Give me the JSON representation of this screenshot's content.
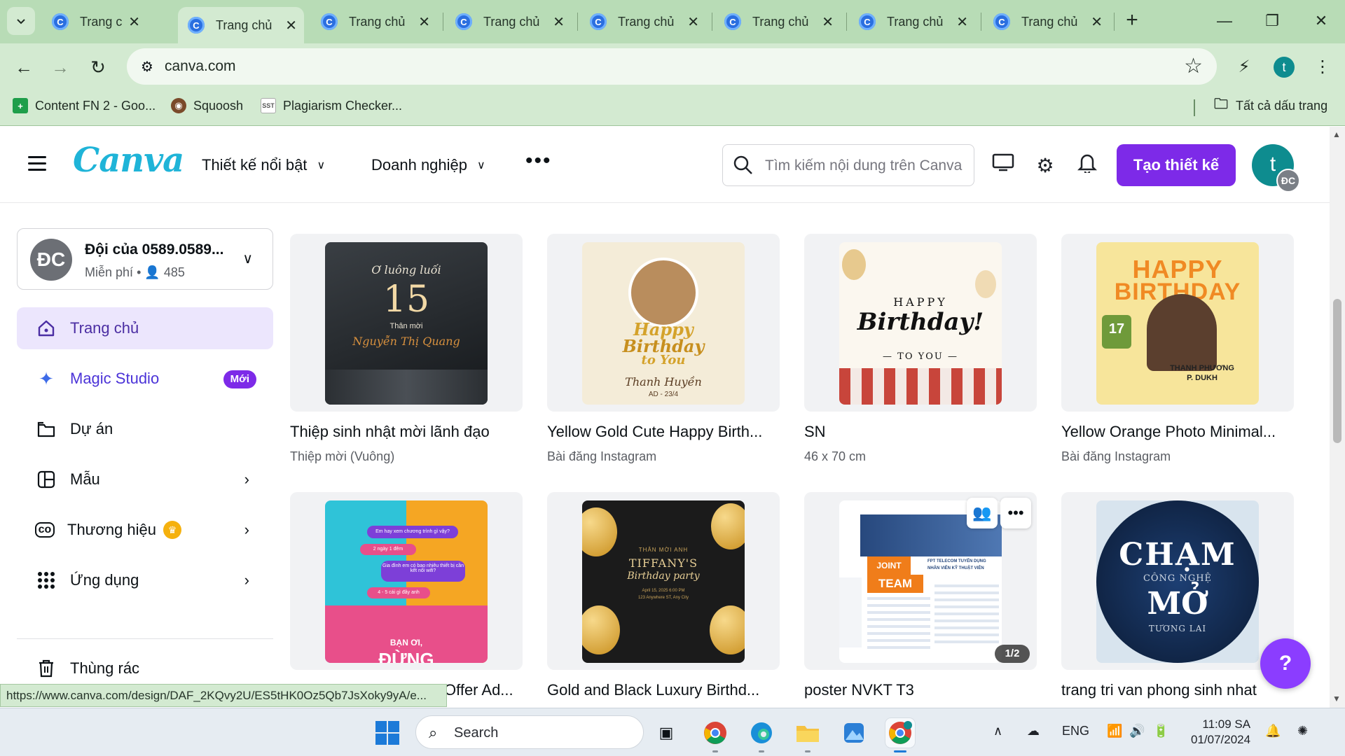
{
  "browser": {
    "tabs": [
      {
        "label": "Trang chủ",
        "active": false
      },
      {
        "label": "Trang chủ",
        "active": true
      },
      {
        "label": "Trang chủ",
        "active": false
      },
      {
        "label": "Trang chủ",
        "active": false
      },
      {
        "label": "Trang chủ",
        "active": false
      },
      {
        "label": "Trang chủ",
        "active": false
      },
      {
        "label": "Trang chủ",
        "active": false
      },
      {
        "label": "Trang chủ",
        "active": false
      }
    ],
    "tab_close": "✕",
    "new_tab": "+",
    "url": "canva.com",
    "profile_initial": "t",
    "bookmarks": [
      {
        "label": "Content FN 2 - Goo...",
        "icon": "plus-doc-icon"
      },
      {
        "label": "Squoosh",
        "icon": "squoosh-icon"
      },
      {
        "label": "Plagiarism Checker...",
        "icon": "sst-icon",
        "icon_text": "SST"
      }
    ],
    "all_bookmarks": "Tất cả dấu trang",
    "status_url": "https://www.canva.com/design/DAF_2KQvy2U/ES5tHK0Oz5Qb7JsXoky9yA/e..."
  },
  "header": {
    "logo": "Canva",
    "nav": [
      {
        "label": "Thiết kế nổi bật"
      },
      {
        "label": "Doanh nghiệp"
      }
    ],
    "more": "•••",
    "search_placeholder": "Tìm kiếm nội dung trên Canva",
    "create_button": "Tạo thiết kế",
    "avatar_initial": "t",
    "avatar_sub": "ĐC"
  },
  "sidebar": {
    "team": {
      "initials": "ĐC",
      "name": "Đội của 0589.0589...",
      "plan": "Miễn phí",
      "members_icon": "person-icon",
      "members": "485"
    },
    "items": [
      {
        "label": "Trang chủ",
        "icon": "home-icon",
        "active": true
      },
      {
        "label": "Magic Studio",
        "icon": "sparkle-icon",
        "badge": "Mới"
      },
      {
        "label": "Dự án",
        "icon": "folder-icon"
      },
      {
        "label": "Mẫu",
        "icon": "template-icon",
        "chevron": true
      },
      {
        "label": "Thương hiệu",
        "icon": "brand-icon",
        "chevron": true,
        "premium": true
      },
      {
        "label": "Ứng dụng",
        "icon": "apps-icon",
        "chevron": true
      },
      {
        "label": "Thùng rác",
        "icon": "trash-icon"
      }
    ]
  },
  "designs": [
    {
      "title": "Thiệp sinh nhật mời lãnh đạo",
      "subtitle": "Thiệp mời (Vuông)",
      "thumb_lines": [
        "Ơ luông luối",
        "15",
        "Thân mời",
        "Nguyễn Thị Quang"
      ]
    },
    {
      "title": "Yellow Gold Cute Happy Birth...",
      "subtitle": "Bài đăng Instagram",
      "thumb_lines": [
        "Happy",
        "Birthday",
        "to You",
        "Thanh Huyền",
        "AD - 23/4"
      ]
    },
    {
      "title": "SN",
      "subtitle": "46 x 70 cm",
      "thumb_lines": [
        "HAPPY",
        "Birthday!",
        "— TO YOU —"
      ]
    },
    {
      "title": "Yellow Orange Photo Minimal...",
      "subtitle": "Bài đăng Instagram",
      "thumb_lines": [
        "HAPPY",
        "BIRTHDAY",
        "17",
        "THANH PHƯƠNG",
        "P. DUKH"
      ]
    },
    {
      "title": "Offer Ad...",
      "subtitle": "",
      "thumb_lines": [
        "Em hay xem chương trình gì vậy?",
        "2 ngày 1 đêm",
        "Gia đình em có bao nhiêu thiết bị cần kết nối wifi?",
        "4 - 5 cái gì đây anh",
        "BẠN ƠI,",
        "ĐỪNG"
      ]
    },
    {
      "title": "Gold and Black Luxury Birthd...",
      "subtitle": "",
      "thumb_lines": [
        "THÂN MỜI ANH",
        "TIFFANY'S",
        "Birthday party",
        "April 15, 2025 6:00 PM",
        "123 Anywhere ST, Any City"
      ]
    },
    {
      "title": "poster NVKT T3",
      "subtitle": "",
      "thumb_lines": [
        "JOINT",
        "TEAM",
        "FPT TELECOM TUYỂN DỤNG",
        "NHÂN VIÊN KỸ THUẬT VIÊN"
      ],
      "page_badge": "1/2",
      "more": "•••"
    },
    {
      "title": "trang tri van phong sinh nhat",
      "subtitle": "",
      "thumb_lines": [
        "CHẠM",
        "CÔNG NGHỆ",
        "MỞ",
        "TƯƠNG LAI"
      ]
    }
  ],
  "help": "?",
  "taskbar": {
    "search": "Search",
    "lang": "ENG",
    "time": "11:09 SA",
    "date": "01/07/2024"
  },
  "colors": {
    "accent": "#7d2ae8",
    "chrome_tabbar": "#b8dcb6",
    "chrome_toolbar": "#d3ead1",
    "active_nav": "#ece6fd",
    "logo": "#1fb4d8"
  }
}
